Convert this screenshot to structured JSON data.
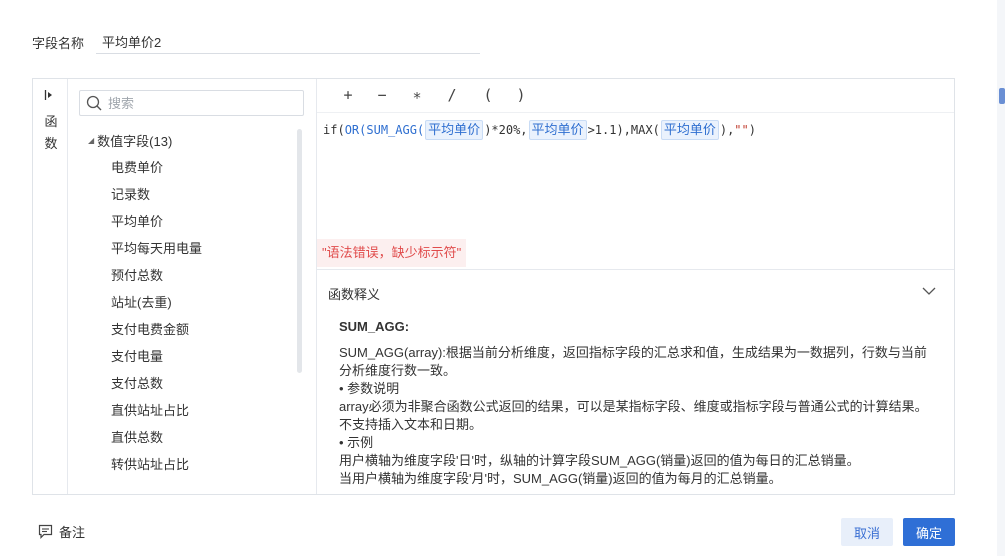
{
  "field": {
    "label": "字段名称",
    "value": "平均单价2"
  },
  "rail": {
    "chars": [
      "函",
      "数"
    ]
  },
  "fields_panel": {
    "search_placeholder": "搜索",
    "group_label": "数值字段(13)",
    "items": [
      "电费单价",
      "记录数",
      "平均单价",
      "平均每天用电量",
      "预付总数",
      "站址(去重)",
      "支付电费金额",
      "支付电量",
      "支付总数",
      "直供站址占比",
      "直供总数",
      "转供站址占比"
    ]
  },
  "operators": [
    "+",
    "−",
    "∗",
    "/",
    "(",
    ")"
  ],
  "formula": {
    "t1": "if(",
    "t2": "OR(",
    "t3": "SUM_AGG(",
    "chip1": "平均单价",
    "t4": ")*20%,",
    "chip2": "平均单价",
    "t5": ">1.1),",
    "t6": "MAX(",
    "chip3": "平均单价",
    "t7": "),",
    "t8": "\"\"",
    "t9": ")"
  },
  "error": "\"语法错误，缺少标示符\"",
  "explain": {
    "title": "函数释义",
    "fn_name": "SUM_AGG:",
    "lines": [
      "SUM_AGG(array):根据当前分析维度，返回指标字段的汇总求和值，生成结果为一数据列，行数与当前分析维度行数一致。",
      "•  参数说明",
      "array必须为非聚合函数公式返回的结果，可以是某指标字段、维度或指标字段与普通公式的计算结果。不支持插入文本和日期。",
      "•  示例",
      "用户横轴为维度字段'日'时，纵轴的计算字段SUM_AGG(销量)返回的值为每日的汇总销量。",
      "当用户横轴为维度字段'月'时，SUM_AGG(销量)返回的值为每月的汇总销量。"
    ]
  },
  "footer": {
    "note_label": "备注",
    "cancel": "取消",
    "ok": "确定"
  },
  "colors": {
    "primary": "#2f6fd6",
    "error": "#e04b4b",
    "chip_bg": "#eaf2fd"
  }
}
